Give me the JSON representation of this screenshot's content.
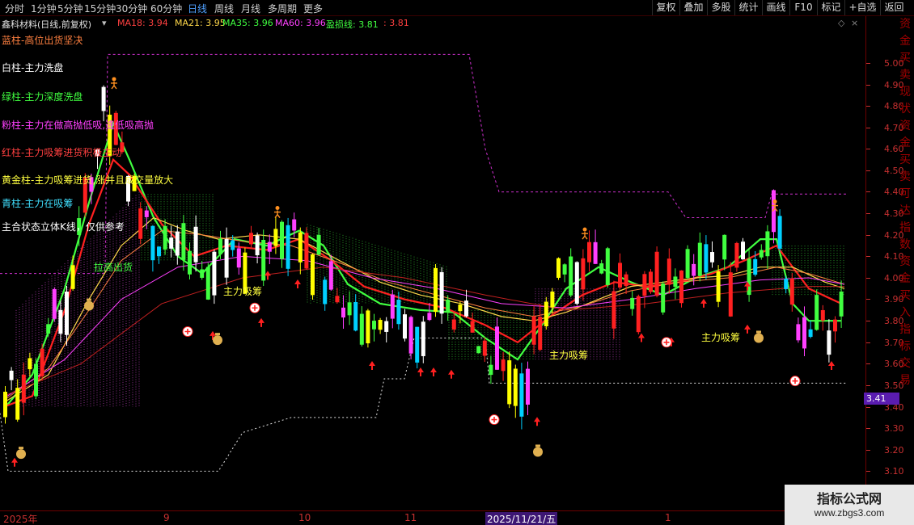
{
  "toolbar": {
    "periods": [
      "分时",
      "1分钟",
      "5分钟",
      "15分钟",
      "30分钟",
      "60分钟",
      "日线",
      "周线",
      "月线",
      "多周期",
      "更多"
    ],
    "active_period": "日线",
    "right_buttons": [
      "复权",
      "叠加",
      "多股",
      "统计",
      "画线",
      "F10",
      "标记",
      "+自选",
      "返回"
    ]
  },
  "info": {
    "stock_name": "鑫科材料(日线,前复权)",
    "ma18": "MA18: 3.94",
    "ma21": "MA21: 3.95",
    "ma35": "MA35: 3.96",
    "ma60": "MA60: 3.96",
    "profit_loss": "盈损线: 3.81",
    "profit_loss_2": ": 3.81"
  },
  "legend": {
    "blue": "蓝柱-高位出货坚决",
    "white": "白柱-主力洗盘",
    "green": "绿柱-主力深度洗盘",
    "pink": "粉柱-主力在做高抛低吸,逢低吸高抛",
    "red": "红柱-主力吸筹进货积极主动",
    "gold": "黄金柱-主力吸筹进货,涨并且成交量放大",
    "cyan": "青柱-主力在吸筹",
    "note": "主合状态立体K线，仅供参考"
  },
  "annotations": {
    "pull_up": "拉高出货",
    "absorb1": "主力吸筹",
    "absorb2": "主力吸筹",
    "absorb3": "主力吸筹"
  },
  "yaxis": {
    "ticks": [
      "5.00",
      "4.90",
      "4.80",
      "4.70",
      "4.60",
      "4.50",
      "4.40",
      "4.30",
      "4.20",
      "4.10",
      "4.00",
      "3.90",
      "3.80",
      "3.70",
      "3.60",
      "3.50",
      "3.40",
      "3.30",
      "3.20",
      "3.10"
    ],
    "current_price": "3.41"
  },
  "xaxis": {
    "labels": [
      "2025年",
      "9",
      "10",
      "11",
      "2025/11/21/五",
      "1"
    ]
  },
  "right_strip": "资金买卖现状资金买卖可达指数资金买入指标交易",
  "watermark": {
    "title": "指标公式网",
    "url": "www.zbgs3.com"
  },
  "colors": {
    "ma18": "#ff4040",
    "ma21": "#ffd84a",
    "ma35": "#40ff40",
    "ma60": "#ff40ff",
    "profit_loss": "#40ff40",
    "up": "#ff2020",
    "down": "#00d0ff",
    "accent_purple": "#5a1cb0"
  }
}
